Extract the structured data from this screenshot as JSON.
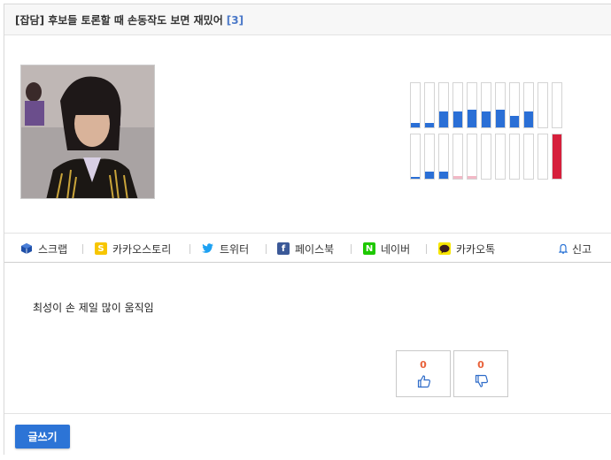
{
  "post": {
    "title": "[잡담] 후보들 토론할 때 손동작도 보면 재밌어",
    "comment_count": "[3]",
    "body": "최성이 손 제일 많이 움직임"
  },
  "widget": {
    "top_row_levels": [
      0.1,
      0.1,
      0.35,
      0.35,
      0.4,
      0.35,
      0.4,
      0.25,
      0.35,
      0,
      0
    ],
    "bottom_row_levels": [
      0.03,
      0.15,
      0.15,
      0.05,
      0.05,
      0,
      0,
      0,
      0,
      0,
      1.0
    ],
    "top_row_colors": [
      "#2a6fd6",
      "#2a6fd6",
      "#2a6fd6",
      "#2a6fd6",
      "#2a6fd6",
      "#2a6fd6",
      "#2a6fd6",
      "#2a6fd6",
      "#2a6fd6",
      "#2a6fd6",
      "#2a6fd6"
    ],
    "bottom_row_colors": [
      "#2a6fd6",
      "#2a6fd6",
      "#2a6fd6",
      "#f2b8c6",
      "#f2b8c6",
      "#2a6fd6",
      "#2a6fd6",
      "#2a6fd6",
      "#2a6fd6",
      "#2a6fd6",
      "#d6203c"
    ]
  },
  "share": {
    "scrap": "스크랩",
    "kakaostory": "카카오스토리",
    "twitter": "트위터",
    "facebook": "페이스북",
    "naver": "네이버",
    "kakaotalk": "카카오톡",
    "report": "신고"
  },
  "votes": {
    "up": "0",
    "down": "0"
  },
  "actions": {
    "write": "글쓰기"
  },
  "colors": {
    "accent": "#2c74d6",
    "vote_count": "#e8623b",
    "comment_count": "#4a78c8"
  }
}
